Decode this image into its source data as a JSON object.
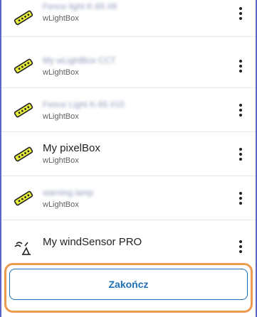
{
  "devices": [
    {
      "title": "Fence light K-65 #9",
      "title_blurred": true,
      "subtitle": "wLightBox",
      "icon": "led-strip-icon"
    },
    {
      "title": "My wLightBox CCT",
      "title_blurred": true,
      "subtitle": "wLightBox",
      "icon": "led-strip-icon"
    },
    {
      "title": "Fence Light K-65 #10",
      "title_blurred": true,
      "subtitle": "wLightBox",
      "icon": "led-strip-icon"
    },
    {
      "title": "My pixelBox",
      "title_blurred": false,
      "subtitle": "wLightBox",
      "icon": "led-strip-icon"
    },
    {
      "title": "warning lamp",
      "title_blurred": true,
      "subtitle": "wLightBox",
      "icon": "led-strip-icon"
    },
    {
      "title": "My windSensor PRO",
      "title_blurred": false,
      "subtitle": "",
      "icon": "wind-sensor-icon"
    }
  ],
  "footer": {
    "finish_label": "Zakończ"
  },
  "colors": {
    "accent": "#1d6fb6",
    "highlight": "#ec9a4f",
    "frame": "#5c63c9",
    "led_yellow": "#e8ef3a"
  }
}
